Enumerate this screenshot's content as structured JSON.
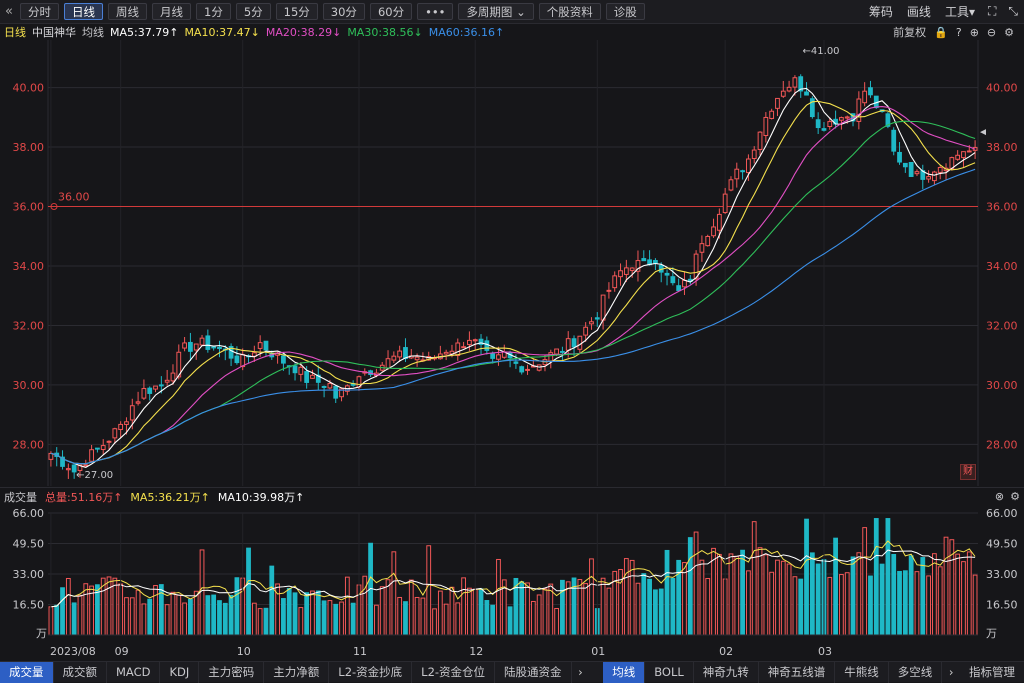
{
  "toolbar": {
    "back_icon": "chevron-double-left-icon",
    "period_buttons": [
      "分时",
      "日线",
      "周线",
      "月线",
      "1分",
      "5分",
      "15分",
      "30分",
      "60分"
    ],
    "active_period": "日线",
    "more_label": "•••",
    "multi_period_label": "多周期图",
    "stock_info_label": "个股资料",
    "diagnose_label": "诊股",
    "right": {
      "chips_label": "筹码",
      "draw_label": "画线",
      "tools_label": "工具"
    }
  },
  "legend": {
    "period": "日线",
    "stock_name": "中国神华",
    "avg_label": "均线",
    "ma5": "MA5:37.79↑",
    "ma10": "MA10:37.47↓",
    "ma20": "MA20:38.29↓",
    "ma30": "MA30:38.56↓",
    "ma60": "MA60:36.16↑",
    "adjust_label": "前复权"
  },
  "colors": {
    "up": "#f25757",
    "down": "#1fb8c6",
    "ma5": "#ffffff",
    "ma10": "#f4e04d",
    "ma20": "#e14fc4",
    "ma30": "#2fbf5a",
    "ma60": "#3a8fe8",
    "hline": "#d23a3a"
  },
  "chart_data": {
    "type": "candlestick",
    "title": "中国神华 日线",
    "y_ticks": [
      "40.00",
      "38.00",
      "36.00",
      "34.00",
      "32.00",
      "30.00",
      "28.00"
    ],
    "ylim": [
      26.6,
      41.6
    ],
    "x_ticks": [
      "2023/08",
      "09",
      "10",
      "11",
      "12",
      "01",
      "02",
      "03"
    ],
    "x_tick_index": [
      0,
      12,
      33,
      53,
      73,
      94,
      116,
      133
    ],
    "horizontal_line": {
      "value": 36.0,
      "label": "36.00"
    },
    "max_annotation": {
      "value": 41.0,
      "label": "←41.00",
      "index": 130
    },
    "min_annotation": {
      "value": 27.0,
      "label": "←27.00",
      "index": 4
    },
    "cai_label": "财",
    "anchors_close": [
      [
        0,
        27.7
      ],
      [
        3,
        27.3
      ],
      [
        4,
        27.1
      ],
      [
        6,
        27.5
      ],
      [
        8,
        27.8
      ],
      [
        10,
        28.2
      ],
      [
        12,
        28.6
      ],
      [
        14,
        29.3
      ],
      [
        16,
        29.8
      ],
      [
        19,
        30.0
      ],
      [
        21,
        30.6
      ],
      [
        23,
        31.2
      ],
      [
        25,
        31.4
      ],
      [
        28,
        31.3
      ],
      [
        31,
        31.0
      ],
      [
        33,
        30.8
      ],
      [
        36,
        31.4
      ],
      [
        38,
        31.1
      ],
      [
        40,
        30.8
      ],
      [
        42,
        30.6
      ],
      [
        44,
        30.2
      ],
      [
        46,
        30.1
      ],
      [
        48,
        30.0
      ],
      [
        49,
        29.6
      ],
      [
        51,
        29.9
      ],
      [
        53,
        30.4
      ],
      [
        56,
        30.6
      ],
      [
        59,
        30.9
      ],
      [
        62,
        31.0
      ],
      [
        65,
        30.8
      ],
      [
        68,
        31.2
      ],
      [
        70,
        31.3
      ],
      [
        72,
        31.6
      ],
      [
        74,
        31.2
      ],
      [
        76,
        30.7
      ],
      [
        78,
        31.0
      ],
      [
        80,
        30.7
      ],
      [
        82,
        30.6
      ],
      [
        84,
        30.8
      ],
      [
        86,
        31.0
      ],
      [
        88,
        31.2
      ],
      [
        90,
        31.5
      ],
      [
        92,
        31.9
      ],
      [
        94,
        32.4
      ],
      [
        96,
        33.2
      ],
      [
        98,
        33.8
      ],
      [
        100,
        34.1
      ],
      [
        102,
        34.0
      ],
      [
        104,
        34.3
      ],
      [
        106,
        33.6
      ],
      [
        108,
        33.1
      ],
      [
        110,
        33.6
      ],
      [
        112,
        34.9
      ],
      [
        114,
        35.5
      ],
      [
        116,
        36.4
      ],
      [
        118,
        37.1
      ],
      [
        120,
        37.6
      ],
      [
        122,
        38.6
      ],
      [
        124,
        39.4
      ],
      [
        126,
        40.0
      ],
      [
        128,
        40.2
      ],
      [
        130,
        39.9
      ],
      [
        132,
        38.6
      ],
      [
        134,
        38.9
      ],
      [
        136,
        39.0
      ],
      [
        138,
        39.1
      ],
      [
        140,
        39.9
      ],
      [
        142,
        39.4
      ],
      [
        144,
        38.6
      ],
      [
        145,
        37.8
      ],
      [
        147,
        37.4
      ],
      [
        149,
        37.0
      ],
      [
        151,
        37.2
      ],
      [
        153,
        37.4
      ],
      [
        155,
        37.6
      ],
      [
        157,
        37.9
      ],
      [
        159,
        37.8
      ]
    ],
    "series": [
      {
        "name": "MA5",
        "value": 37.79
      },
      {
        "name": "MA10",
        "value": 37.47
      },
      {
        "name": "MA20",
        "value": 38.29
      },
      {
        "name": "MA30",
        "value": 38.56
      },
      {
        "name": "MA60",
        "value": 36.16
      }
    ],
    "volume": {
      "total_label": "总量:51.16万↑",
      "ma5_label": "MA5:36.21万↑",
      "ma10_label": "MA10:39.98万↑",
      "y_ticks": [
        "66.00",
        "49.50",
        "33.00",
        "16.50"
      ],
      "unit_label": "万",
      "ylim": [
        0,
        66
      ],
      "unit": "万"
    }
  },
  "vol_header": {
    "label": "成交量"
  },
  "bottom_tabs": {
    "left": [
      "成交量",
      "成交额",
      "MACD",
      "KDJ",
      "主力密码",
      "主力净额",
      "L2-资金抄底",
      "L2-资金仓位",
      "陆股通资金"
    ],
    "right": [
      "均线",
      "BOLL",
      "神奇九转",
      "神奇五线谱",
      "牛熊线",
      "多空线"
    ],
    "manage_label": "指标管理"
  }
}
